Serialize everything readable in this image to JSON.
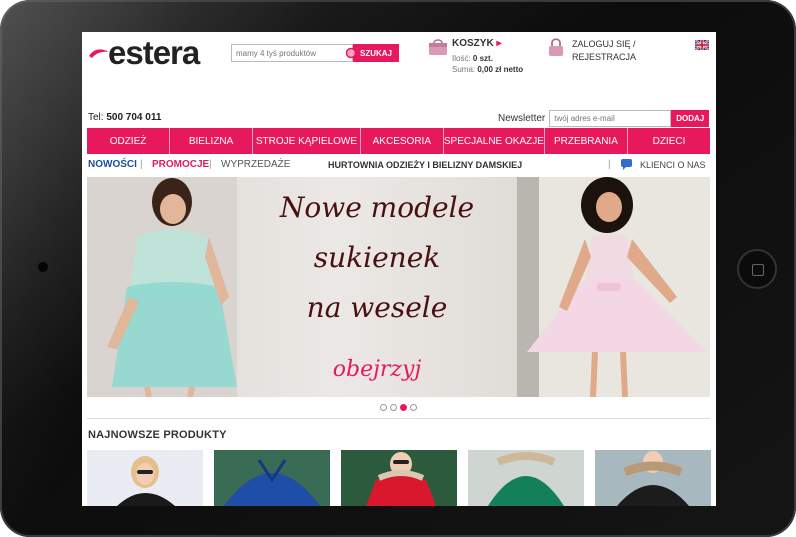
{
  "header": {
    "logo_text": "estera",
    "search": {
      "placeholder": "mamy 4 tyś produktów",
      "button_label": "SZUKAJ"
    },
    "cart": {
      "title": "KOSZYK",
      "qty_label": "Ilość:",
      "qty_value": "0 szt.",
      "sum_label": "Suma:",
      "sum_value": "0,00 zł netto"
    },
    "login": {
      "line1": "ZALOGUJ SIĘ /",
      "line2": "REJESTRACJA"
    }
  },
  "contact": {
    "phone_label": "Tel:",
    "phone_value": "500 704 011"
  },
  "newsletter": {
    "label": "Newsletter",
    "placeholder": "twój adres e-mail",
    "button_label": "DODAJ"
  },
  "nav": {
    "items": [
      {
        "label": "ODZIEŻ"
      },
      {
        "label": "BIELIZNA"
      },
      {
        "label": "STROJE KĄPIELOWE"
      },
      {
        "label": "AKCESORIA"
      },
      {
        "label": "SPECJALNE OKAZJE"
      },
      {
        "label": "PRZEBRANIA"
      },
      {
        "label": "DZIECI"
      }
    ]
  },
  "subnav": {
    "new": "NOWOŚCI",
    "promo": "PROMOCJE",
    "sale": "WYPRZEDAŻE",
    "sep": "|",
    "center": "HURTOWNIA ODZIEŻY I BIELIZNY DAMSKIEJ",
    "clients": "KLIENCI O NAS"
  },
  "banner": {
    "line1": "Nowe modele",
    "line2": "sukienek",
    "line3": "na wesele",
    "cta": "obejrzyj",
    "active_slide": 3,
    "slide_count": 4
  },
  "products": {
    "title": "NAJNOWSZE PRODUKTY"
  },
  "colors": {
    "brand": "#e8185d",
    "link_blue": "#1a4f9f"
  }
}
